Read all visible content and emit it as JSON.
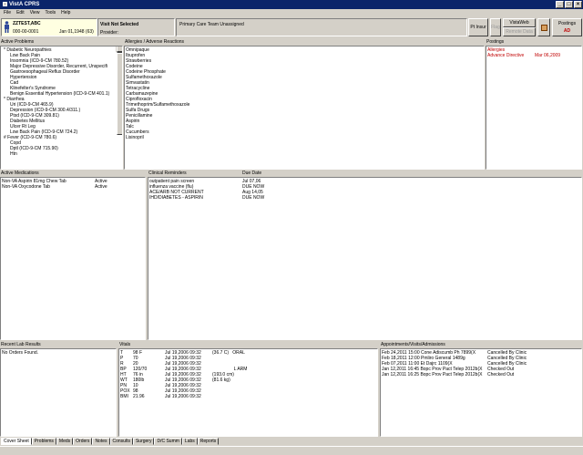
{
  "window": {
    "title": "VistA CPRS"
  },
  "menu": [
    "File",
    "Edit",
    "View",
    "Tools",
    "Help"
  ],
  "patient": {
    "name": "ZZTEST,ABC",
    "ssn": "000-00-0001",
    "dob": "Jan 01,1948 (63)"
  },
  "visit": {
    "title": "Visit Not Selected",
    "provider_label": "Provider:"
  },
  "pcp": {
    "text": "Primary Care Team Unassigned"
  },
  "toolbar": {
    "primary_label": "Pt Insur",
    "flag_label": "Flag",
    "vistaweb_label": "VistaWeb",
    "remote_data_label": "Remote Data",
    "postings_label": "Postings",
    "postings_code": "AD"
  },
  "problems": {
    "title": "Active Problems",
    "items": [
      "* Diabetic Neuropathies",
      "Low Back Pain",
      "Insomnia (ICD-9-CM 780.52)",
      "Major Depressive Disorder, Recurrent, Unspecifi",
      "Gastroesophageal Reflux Disorder",
      "Hypertension",
      "Cad",
      "Klinefelter's Syndrome",
      "Benign Essential Hypertension (ICD-9-CM 401.1)",
      "* Diarrhea",
      "Uri (ICD-9-CM 465.9)",
      "Depression (ICD-9-CM 300.4/311.)",
      "Ptsd (ICD-9-CM 309.81)",
      "Diabetes Mellitus",
      "Ulcer Rt Leg",
      "Low Back Pain (ICD-9-CM 724.2)",
      "# Fever (ICD-9-CM 780.6)",
      "Copd",
      "Dptl (ICD-9-CM 715.90)",
      "Htn"
    ]
  },
  "allergies": {
    "title": "Allergies / Adverse Reactions",
    "items": [
      "Omnipaque",
      "Ibuprofen",
      "Strawberries",
      "Codeine",
      "Codeine Phosphate",
      "Sulfamethoxazole",
      "Simvastatin",
      "Tetracycline",
      "Carbamazepine",
      "Ciprofloxacin",
      "Trimethoprim/Sulfamethoxazole",
      "Sulfa Drugs",
      "Penicillamine",
      "Aspirin",
      "Talc",
      "Cucumbers",
      "Lisinopril"
    ]
  },
  "postings": {
    "title": "Postings",
    "items": [
      {
        "label": "Allergies",
        "date": ""
      },
      {
        "label": "Advance Directive",
        "date": "Mar 06,2009"
      }
    ]
  },
  "medications": {
    "title": "Active Medications",
    "items": [
      {
        "name": "Non-VA  Aspirin 81mg Chew Tab",
        "status": "Active"
      },
      {
        "name": "Non-VA  Oxycodone Tab",
        "status": "Active"
      }
    ]
  },
  "reminders": {
    "title": "Clinical Reminders",
    "due_header": "Due Date",
    "items": [
      {
        "name": "outpatient pain screen",
        "due": "Jul 07,06"
      },
      {
        "name": "influenza vaccine (flu)",
        "due": "DUE NOW"
      },
      {
        "name": "ACE/ARB NOT CURRENT",
        "due": "Aug 14,05"
      },
      {
        "name": "IHD/DIABETES - ASPIRIN",
        "due": "DUE NOW"
      }
    ]
  },
  "labs": {
    "title": "Recent Lab Results",
    "items": [
      "No Orders Found."
    ]
  },
  "vitals": {
    "title": "Vitals",
    "items": [
      {
        "code": "T",
        "value": "98 F",
        "date": "Jul 19,2006 09:32",
        "extra": "(36.7 C)   ORAL"
      },
      {
        "code": "P",
        "value": "70",
        "date": "Jul 19,2006 09:32",
        "extra": ""
      },
      {
        "code": "R",
        "value": "20",
        "date": "Jul 19,2006 09:32",
        "extra": ""
      },
      {
        "code": "BP",
        "value": "120/70",
        "date": "Jul 19,2006 09:32",
        "extra": "                 L ARM"
      },
      {
        "code": "HT",
        "value": "76 in",
        "date": "Jul 19,2006 09:32",
        "extra": "(193.0 cm)"
      },
      {
        "code": "WT",
        "value": "180lb",
        "date": "Jul 19,2006 09:32",
        "extra": "(81.6 kg)"
      },
      {
        "code": "PN",
        "value": "10",
        "date": "Jul 19,2006 09:32",
        "extra": ""
      },
      {
        "code": "POX",
        "value": "98",
        "date": "Jul 19,2006 09:32",
        "extra": ""
      },
      {
        "code": "BMI",
        "value": "21.96",
        "date": "Jul 19,2006 09:32",
        "extra": ""
      }
    ]
  },
  "appointments": {
    "title": "Appointments/Visits/Admissions",
    "items": [
      {
        "text": "Feb 24,2011 15:00 Cone Adiscumb Ph 7899(X",
        "status": "Cancelled By Clinic"
      },
      {
        "text": "Feb 18,2011 12:00 Pmliro General 1489g",
        "status": "Cancelled By Clinic"
      },
      {
        "text": "Feb 07,2011 11:00 Et Dajrc 1109(X",
        "status": "Cancelled By Clinic"
      },
      {
        "text": "Jan 12,2011 16:45 Bopc Prov Pact Telep 2012b(X",
        "status": "Checked Out"
      },
      {
        "text": "Jan 12,2011 16:25 Bopc Prov Pact Telep 2012b(X",
        "status": "Checked Out"
      }
    ]
  },
  "tabs": [
    "Cover Sheet",
    "Problems",
    "Meds",
    "Orders",
    "Notes",
    "Consults",
    "Surgery",
    "D/C Summ",
    "Labs",
    "Reports"
  ]
}
